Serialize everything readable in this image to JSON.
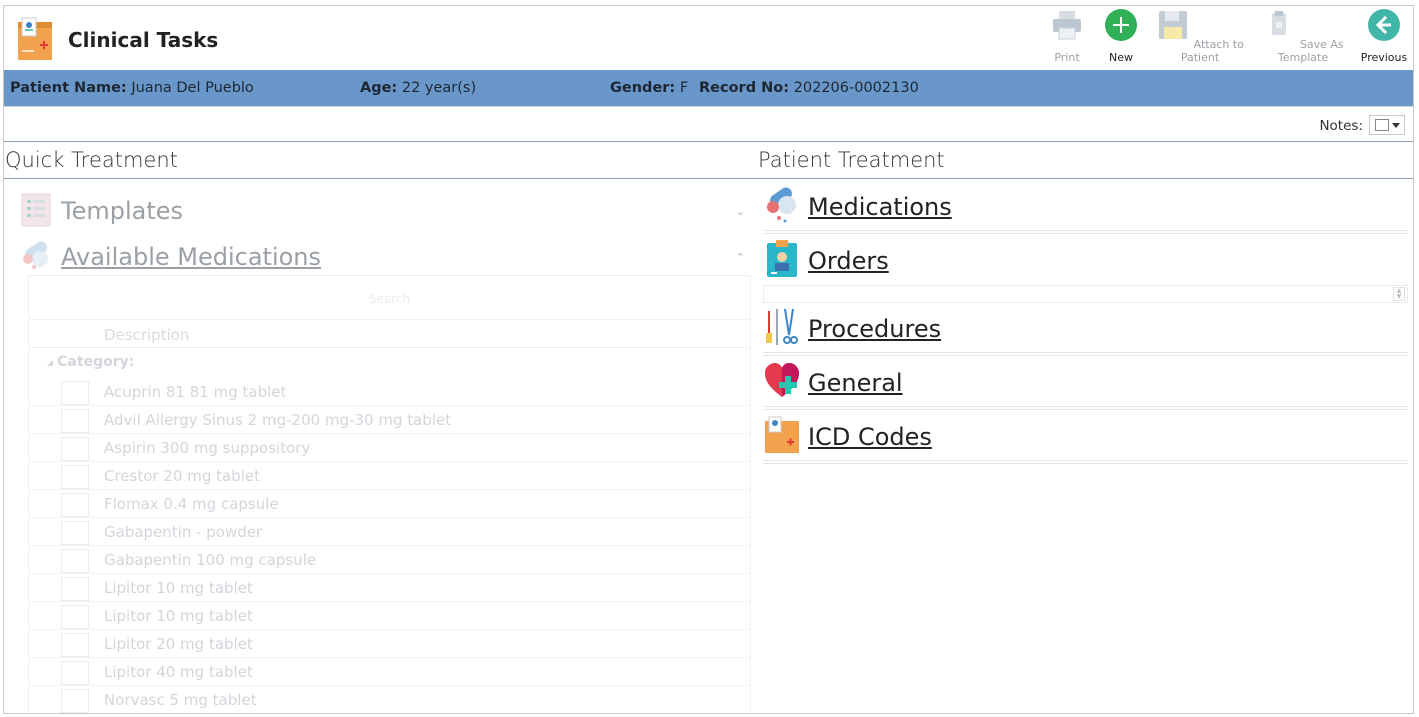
{
  "header": {
    "title": "Clinical Tasks",
    "toolbar": {
      "print": "Print",
      "new": "New",
      "attach": "Attach to Patient",
      "save_template": "Save As Template",
      "previous": "Previous"
    }
  },
  "patient": {
    "name_label": "Patient Name:",
    "name": "Juana Del Pueblo",
    "age_label": "Age:",
    "age": "22 year(s)",
    "gender_label": "Gender:",
    "gender": "F",
    "record_label": "Record No:",
    "record": "202206-0002130"
  },
  "notes": {
    "label": "Notes:"
  },
  "quick_treatment": {
    "title": "Quick Treatment",
    "templates_label": "Templates",
    "available_label": "Available Medications",
    "grid": {
      "search_placeholder": "Search",
      "column_description": "Description",
      "category_label": "Category:",
      "items": [
        "Acuprin 81 81 mg tablet",
        "Advil Allergy Sinus 2 mg-200 mg-30 mg tablet",
        "Aspirin 300 mg suppository",
        "Crestor 20 mg tablet",
        "Flomax 0.4 mg capsule",
        "Gabapentin - powder",
        "Gabapentin 100 mg capsule",
        "Lipitor 10 mg tablet",
        "Lipitor 10 mg tablet",
        "Lipitor 20 mg tablet",
        "Lipitor 40 mg tablet",
        "Norvasc 5 mg tablet"
      ]
    }
  },
  "patient_treatment": {
    "title": "Patient Treatment",
    "items": {
      "medications": "Medications",
      "orders": "Orders",
      "procedures": "Procedures",
      "general": "General",
      "icd": "ICD Codes"
    }
  },
  "colors": {
    "patient_bar": "#6a97c9",
    "new_button": "#2fb157",
    "previous_button": "#3fb6a8"
  }
}
